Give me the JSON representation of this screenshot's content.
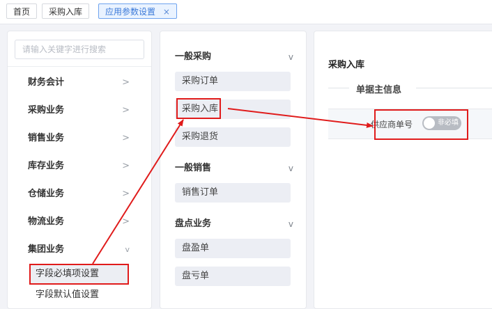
{
  "tabs": [
    {
      "label": "首页"
    },
    {
      "label": "采购入库"
    },
    {
      "label": "应用参数设置",
      "close": "×"
    }
  ],
  "search": {
    "placeholder": "请输入关键字进行搜索"
  },
  "sidebar": {
    "categories": [
      {
        "label": "财务会计",
        "chevron": ">"
      },
      {
        "label": "采购业务",
        "chevron": ">"
      },
      {
        "label": "销售业务",
        "chevron": ">"
      },
      {
        "label": "库存业务",
        "chevron": ">"
      },
      {
        "label": "仓储业务",
        "chevron": ">"
      },
      {
        "label": "物流业务",
        "chevron": ">"
      },
      {
        "label": "集团业务",
        "chevron": "v"
      }
    ],
    "subitems": [
      {
        "label": "字段必填项设置"
      },
      {
        "label": "字段默认值设置"
      }
    ]
  },
  "middle": {
    "groups": [
      {
        "label": "一般采购",
        "chevron": "v",
        "items": [
          "采购订单",
          "采购入库",
          "采购退货"
        ]
      },
      {
        "label": "一般销售",
        "chevron": "v",
        "items": [
          "销售订单"
        ]
      },
      {
        "label": "盘点业务",
        "chevron": "v",
        "items": [
          "盘盈单",
          "盘亏单"
        ]
      }
    ]
  },
  "detail": {
    "title": "采购入库",
    "section": "单据主信息",
    "field": {
      "label": "供应商单号",
      "toggle_label": "非必填"
    }
  },
  "colors": {
    "accent": "#3b79d8",
    "annotation": "#e01b1b"
  }
}
